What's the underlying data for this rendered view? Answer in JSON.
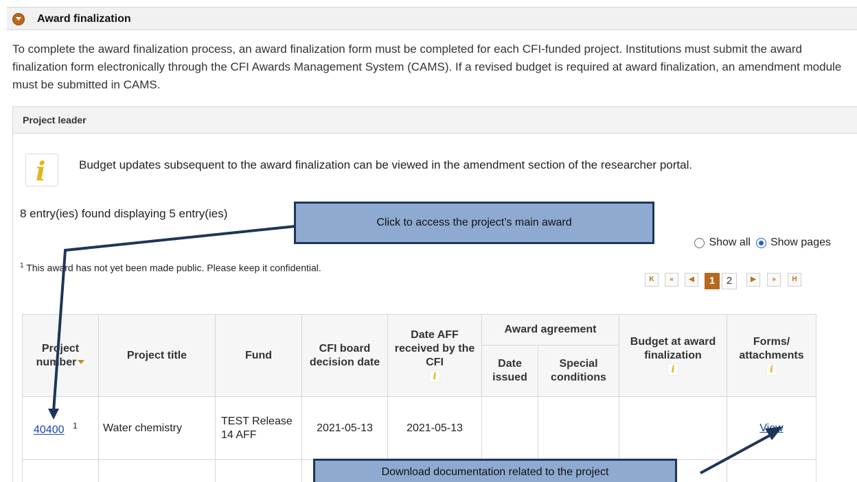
{
  "section": {
    "title": "Award finalization",
    "description": "To complete the award finalization process, an award finalization form must be completed for each CFI-funded project. Institutions must submit the award finalization form electronically through the CFI Awards Management System (CAMS). If a revised budget is required at award finalization, an amendment module must be submitted in CAMS."
  },
  "panel": {
    "title": "Project leader",
    "info_text": "Budget updates subsequent to the award finalization can be viewed in the amendment section of the researcher portal.",
    "entries_text": "8 entry(ies) found displaying 5 entry(ies)",
    "footnote_mark": "1",
    "footnote_text": " This award has not yet been made public. Please keep it confidential.",
    "radio_show_all": "Show all",
    "radio_show_pages": "Show pages",
    "selected_radio": "Show pages"
  },
  "pager": {
    "first": "K",
    "prev_many": "«",
    "prev": "◀",
    "pages": [
      "1",
      "2"
    ],
    "current_page": "1",
    "next": "▶",
    "next_many": "»",
    "last": "H"
  },
  "table": {
    "headers": {
      "project_number": "Project number",
      "project_title": "Project title",
      "fund": "Fund",
      "board_date": "CFI board decision date",
      "date_aff": "Date AFF received by the CFI",
      "award_agreement": "Award agreement",
      "date_issued": "Date issued",
      "special_conditions": "Special conditions",
      "budget": "Budget at award finalization",
      "forms": "Forms/ attachments"
    },
    "info_glyph": "i",
    "rows": [
      {
        "project_number": "40400",
        "footnote": "1",
        "project_title": "Water chemistry",
        "fund": "TEST Release 14 AFF",
        "board_date": "2021-05-13",
        "date_aff": "2021-05-13",
        "date_issued": "",
        "special_conditions": "",
        "budget": "",
        "forms_link": "View"
      }
    ]
  },
  "callouts": {
    "top": "Click to access the project’s main award",
    "bottom": "Download documentation related to the project"
  },
  "colors": {
    "accent": "#b56a1f",
    "callout_fill": "#8eaad0",
    "callout_border": "#1f3558",
    "link": "#1a44a8",
    "info_icon": "#e8b416"
  }
}
